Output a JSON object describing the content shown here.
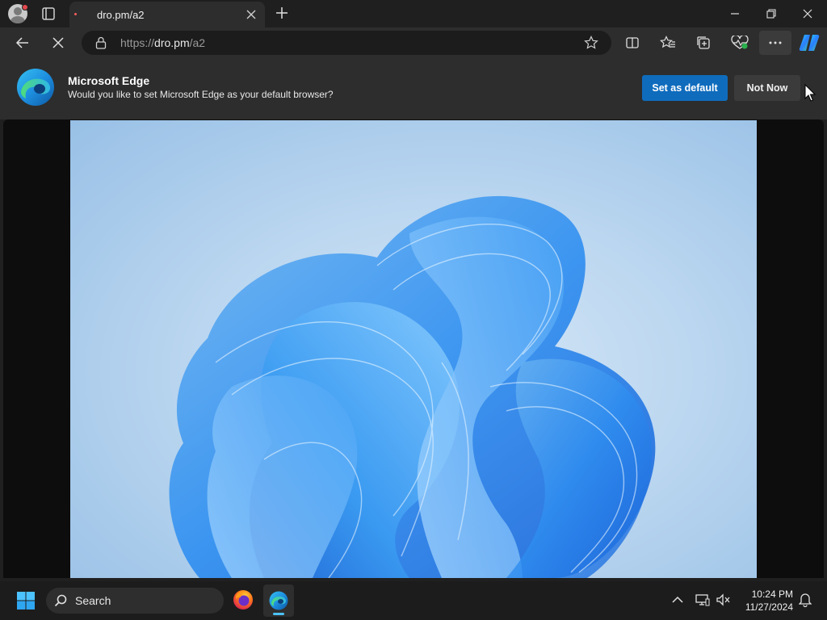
{
  "tab": {
    "title": "dro.pm/a2"
  },
  "address": {
    "scheme": "https://",
    "host": "dro.pm",
    "path": "/a2"
  },
  "infobar": {
    "title": "Microsoft Edge",
    "message": "Would you like to set Microsoft Edge as your default browser?",
    "primary_label": "Set as default",
    "secondary_label": "Not Now"
  },
  "taskbar": {
    "search_label": "Search",
    "time": "10:24 PM",
    "date": "11/27/2024"
  },
  "colors": {
    "accent": "#0f6cbd",
    "taskbar_indicator": "#4cc2ff"
  },
  "icons": {
    "profile": "profile-avatar-icon",
    "tab_actions": "tab-actions-icon",
    "close_tab": "close-icon",
    "new_tab": "plus-icon",
    "back": "arrow-left-icon",
    "stop": "stop-icon",
    "lock": "lock-icon",
    "favorite": "star-icon",
    "split": "split-screen-icon",
    "favorites": "favorites-icon",
    "collections": "collections-icon",
    "performance": "heart-pulse-icon",
    "more": "more-icon",
    "copilot": "copilot-icon",
    "visual_search": "visual-search-icon"
  }
}
